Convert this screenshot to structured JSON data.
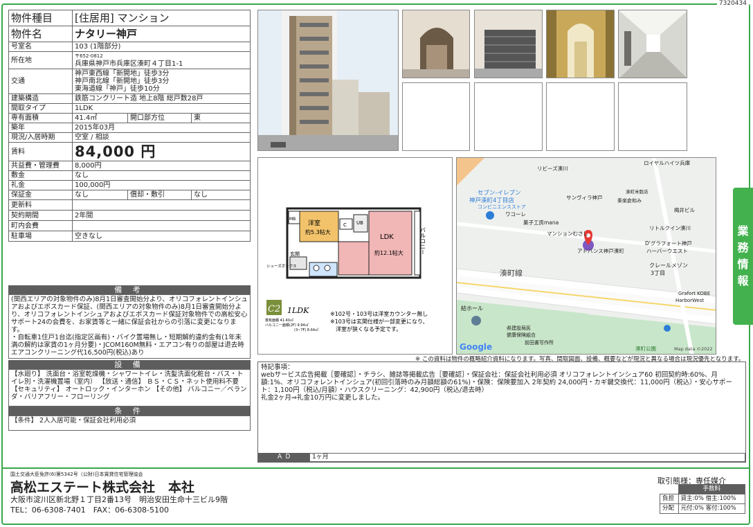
{
  "doc_id": "7320434",
  "property": {
    "rows": [
      {
        "label": "物件種目",
        "value": "[住居用] マンション"
      },
      {
        "label": "物件名",
        "value": "ナタリー神戸"
      },
      {
        "label": "号室名",
        "value": "103 (1階部分)"
      },
      {
        "label": "所在地",
        "zip": "〒652-0812",
        "value": "兵庫県神戸市兵庫区湊町４丁目1-1"
      },
      {
        "label": "交通",
        "lines": [
          "神戸東西線「新開地」徒歩3分",
          "神戸南北線「新開地」徒歩3分",
          "東海道線「神戸」徒歩10分"
        ]
      },
      {
        "label": "建築構造",
        "value": "鉄筋コンクリート造 地上8階 総戸数28戸"
      },
      {
        "label": "間取タイプ",
        "value": "1LDK"
      },
      {
        "label": "専有面積",
        "value": "41.4㎡",
        "label2": "開口部方位",
        "value2": "東"
      },
      {
        "label": "築年",
        "value": "2015年03月"
      },
      {
        "label": "現況/入居時期",
        "value": "空室 / 相談"
      },
      {
        "label": "賃料",
        "value": "84,000 円"
      },
      {
        "label": "共益費・管理費",
        "value": "8,000円"
      },
      {
        "label": "敷金",
        "value": "なし"
      },
      {
        "label": "礼金",
        "value": "100,000円"
      },
      {
        "label": "保証金",
        "value": "なし",
        "label2": "償却・敷引",
        "value2": "なし"
      },
      {
        "label": "更新料",
        "value": ""
      },
      {
        "label": "契約期間",
        "value": "2年間"
      },
      {
        "label": "町内会費",
        "value": ""
      },
      {
        "label": "駐車場",
        "value": "空きなし"
      }
    ]
  },
  "remarks": {
    "title": "備 考",
    "text": "(関西エリアの対象物件のみ)8月1日審査開始分より、オリコフォレントインシュアおよびエポスカード保証、(関西エリアの対象物件のみ)8月1日審査開始分より、オリコフォレントインシュアおよびエポスカード保証対象物件での高松安心サポート24の会費を、お家賃等と一緒に保証会社からの引落に変更になります。\n・自転車1住戸1台迄(指定区画有)・バイク置場無し・短期解約違約金有(1年未満の解約は家賃の1ヶ月分要)・JCOM160M無料・エアコン有りの部屋は退去時エアコンクリーニング代16,500円(税込)あり"
  },
  "equipment": {
    "title": "設 備",
    "text": "【水廻り】 洗面台・浴室乾燥機・シャワートイレ・洗髪洗面化粧台・バス・トイレ別・洗濯機置場（室内） 【放送・通信】 ＢＳ・ＣＳ・ネット使用料不要 【セキュリティ】 オートロック・インターホン 【その他】 バルコニー／ベランダ・バリアフリー・フローリング"
  },
  "conditions": {
    "title": "条 件",
    "text": "【条件】 2人入居可能・保証会社利用必須"
  },
  "floorplan": {
    "rooms": {
      "western": "洋室",
      "western_size": "約5.3帖大",
      "ldk": "LDK",
      "ldk_size": "約12.1帖大",
      "balcony": "バルコニー",
      "entrance": "玄関",
      "shoebox": "シューズボックス",
      "mb": "MB",
      "ub": "UB",
      "c": "C"
    },
    "type_code": "C2",
    "layout": "1LDK",
    "spec_rows": [
      "専有面積 41.40㎡",
      "バルコニー面積(2F) 9.94㎡",
      "(3~7F) 8.64㎡"
    ],
    "notes": [
      "※102号・103号は洋室カウンター無し",
      "※103号は玄関仕様が一部変更になり、",
      "洋室が狭くなる予定です。"
    ]
  },
  "map": {
    "labels": [
      "リビーズ湊川",
      "ロイヤルハイツ兵庫",
      "セブン-イレブン",
      "神戸湊町4丁目店",
      "コンビニエンスストア",
      "サンヴィラ神戸",
      "湊町米穀店",
      "秦楽倉和み",
      "ワコーレ",
      "梅井ビル",
      "菓子工房mana",
      "マンションむさし",
      "リトルクイン湊川",
      "D'グラフォート神戸",
      "ハーバーウエスト",
      "アドバンス神戸湊町",
      "湊町線",
      "クレールメゾン",
      "3丁目",
      "Grafort KOBE",
      "HarborWest",
      "結ホール",
      "県建設局民",
      "健康保険組合",
      "前田書写作所",
      "湊町公園",
      "Map data ©2022"
    ],
    "google": "Google"
  },
  "disclaimer": "※ この資料は物件の概略紹介資料になります。写真、間取図面、設備、概要などが現況と異なる場合は現況優先となります。",
  "special": {
    "title": "特記事項：",
    "text": "webサービス広告掲載［要確認］・チラシ、雑誌等掲載広告［要確認］・保証会社：保証会社利用必須 オリコフォレントインシュア60 初回契約時:60%、月額:1%、オリコフォレントインシュア(初回引落時のみ月額総額の61%)・保険：保険要加入 2年契約 24,000円・カギ鍵交換代：11,000円（税込）・安心サポート：1,100円（税込/月額）・ハウスクリーニング：42,900円（税込/退去時）\n礼金2ヶ月⇒礼金10万円に変更しました。"
  },
  "ad": {
    "label": "Ａ Ｄ",
    "value": "1ヶ月"
  },
  "side_tab": [
    "業",
    "務",
    "情",
    "報"
  ],
  "company": {
    "license": "国土交通大臣免許(6)第5342号（公財)日本賃貸住宅管理協会",
    "name": "高松エステート株式会社　本社",
    "address": "大阪市淀川区新北野１丁目2番13号　明治安田生命十三ビル9階",
    "tel": "TEL：06-6308-7401　FAX：06-6308-5100"
  },
  "transaction": {
    "mode": "取引態様：専任媒介",
    "fee_header": "手数料",
    "rows": [
      {
        "label": "負担",
        "value": "貸主:0% 借主:100%"
      },
      {
        "label": "分配",
        "value": "元付:0% 客付:100%"
      }
    ]
  },
  "colors": {
    "accent_green": "#3aa64a",
    "section_gray": "#5d5d5d"
  }
}
